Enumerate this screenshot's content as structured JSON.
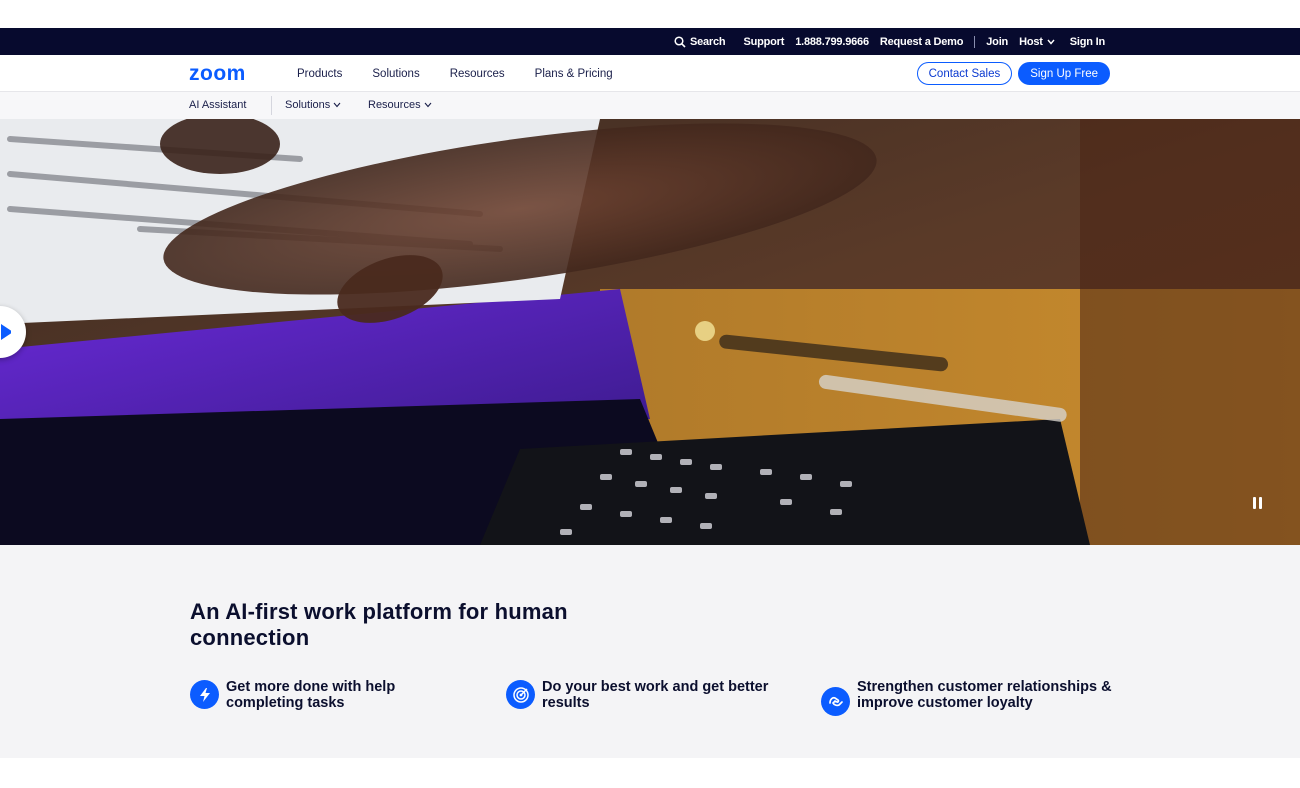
{
  "utility": {
    "search": "Search",
    "support": "Support",
    "phone": "1.888.799.9666",
    "demo": "Request a Demo",
    "join": "Join",
    "host": "Host",
    "signin": "Sign In"
  },
  "nav": {
    "logo": "zoom",
    "links": [
      "Products",
      "Solutions",
      "Resources",
      "Plans & Pricing"
    ],
    "contact_sales": "Contact Sales",
    "sign_up": "Sign Up Free"
  },
  "subnav": {
    "title": "AI Assistant",
    "items": [
      "Solutions",
      "Resources"
    ]
  },
  "hero": {
    "video_state": "playing"
  },
  "features": {
    "heading": "An AI-first work platform for human connection",
    "items": [
      {
        "icon": "lightning-icon",
        "text": "Get more done with help completing tasks"
      },
      {
        "icon": "target-icon",
        "text": "Do your best work and get better results"
      },
      {
        "icon": "handshake-icon",
        "text": "Strengthen customer relationships & improve customer loyalty"
      }
    ]
  },
  "colors": {
    "brand_blue": "#0b5cff",
    "utility_bg": "#070a2e",
    "section_bg": "#f4f4f6"
  }
}
